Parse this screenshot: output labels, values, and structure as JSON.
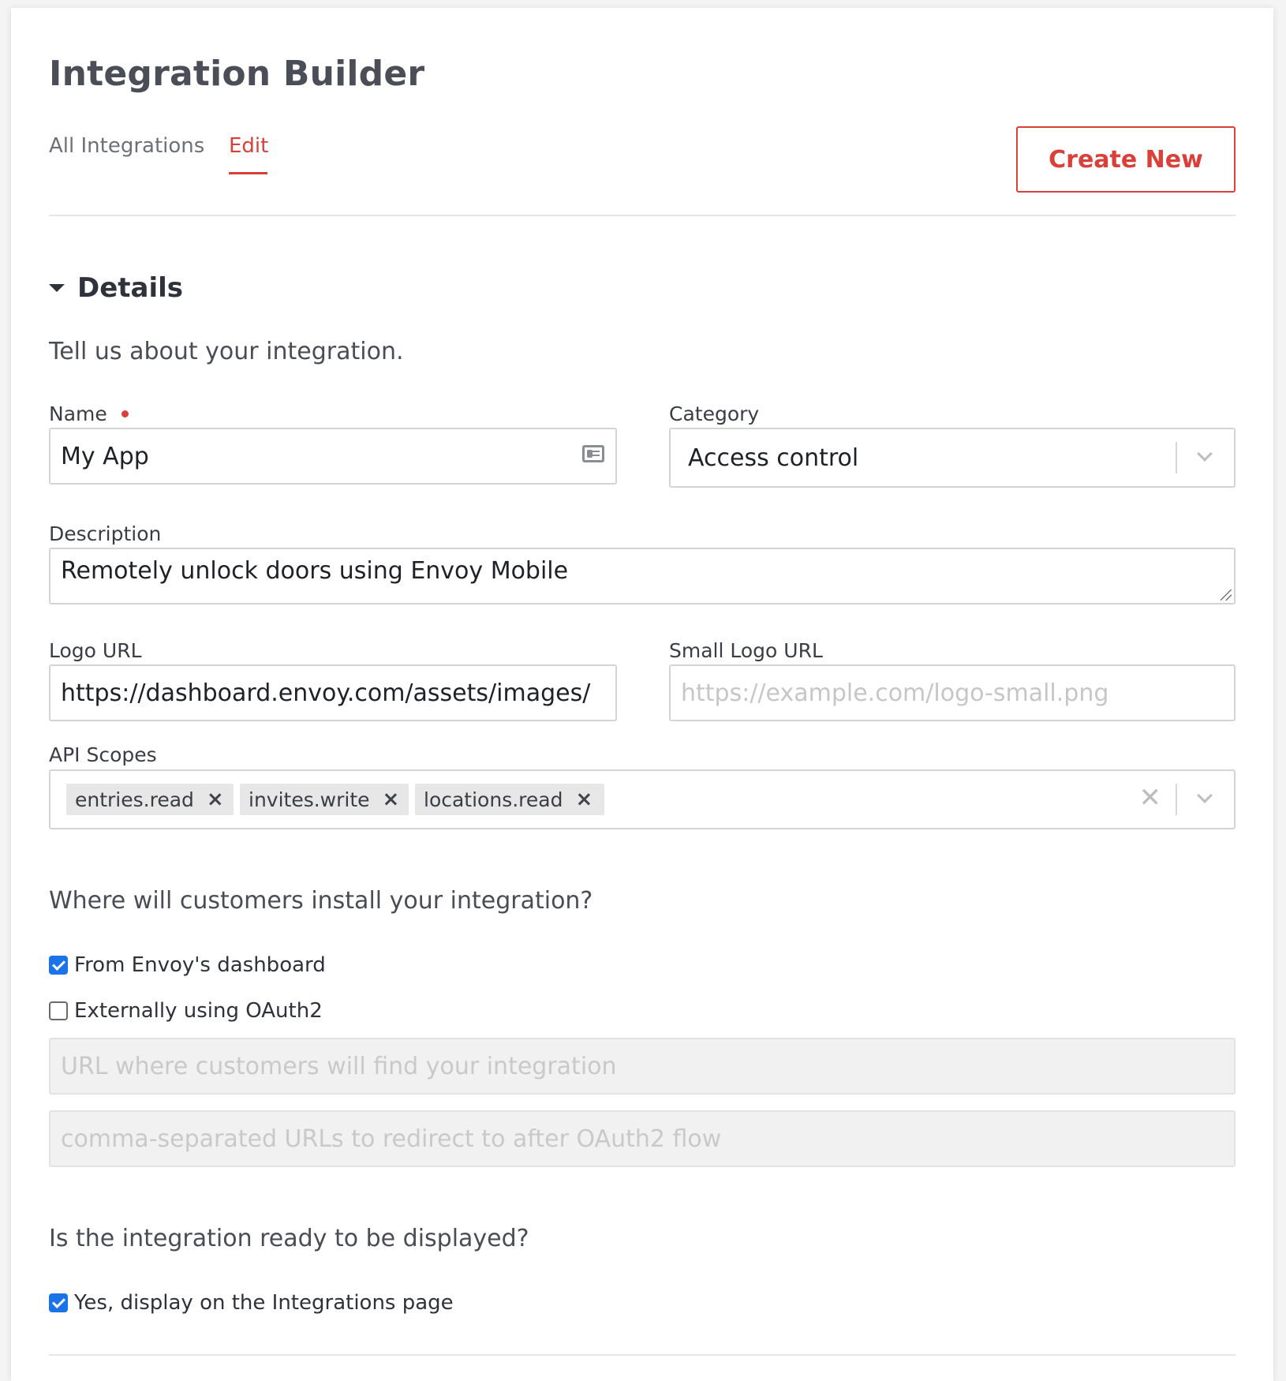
{
  "header": {
    "title": "Integration Builder",
    "create_button": "Create New"
  },
  "tabs": [
    {
      "label": "All Integrations",
      "active": false
    },
    {
      "label": "Edit",
      "active": true
    }
  ],
  "details": {
    "title": "Details",
    "intro": "Tell us about your integration.",
    "name": {
      "label": "Name",
      "value": "My App",
      "required": true,
      "icon": "contact-card-icon"
    },
    "category": {
      "label": "Category",
      "value": "Access control"
    },
    "description": {
      "label": "Description",
      "value": "Remotely unlock doors using Envoy Mobile"
    },
    "logo_url": {
      "label": "Logo URL",
      "value": "https://dashboard.envoy.com/assets/images/"
    },
    "small_logo_url": {
      "label": "Small Logo URL",
      "placeholder": "https://example.com/logo-small.png"
    },
    "api_scopes": {
      "label": "API Scopes",
      "chips": [
        "entries.read",
        "invites.write",
        "locations.read"
      ],
      "remove_glyph": "×",
      "clear_glyph": "✕"
    }
  },
  "install": {
    "question": "Where will customers install your integration?",
    "options": [
      {
        "label": "From Envoy's dashboard",
        "checked": true
      },
      {
        "label": "Externally using OAuth2",
        "checked": false
      }
    ],
    "oauth_url_placeholder": "URL where customers will find your integration",
    "redirect_placeholder": "comma-separated URLs to redirect to after OAuth2 flow"
  },
  "display": {
    "question": "Is the integration ready to be displayed?",
    "option": {
      "label": "Yes, display on the Integrations page",
      "checked": true
    }
  },
  "colors": {
    "accent": "#d9403a",
    "checkbox": "#1a73e8"
  }
}
